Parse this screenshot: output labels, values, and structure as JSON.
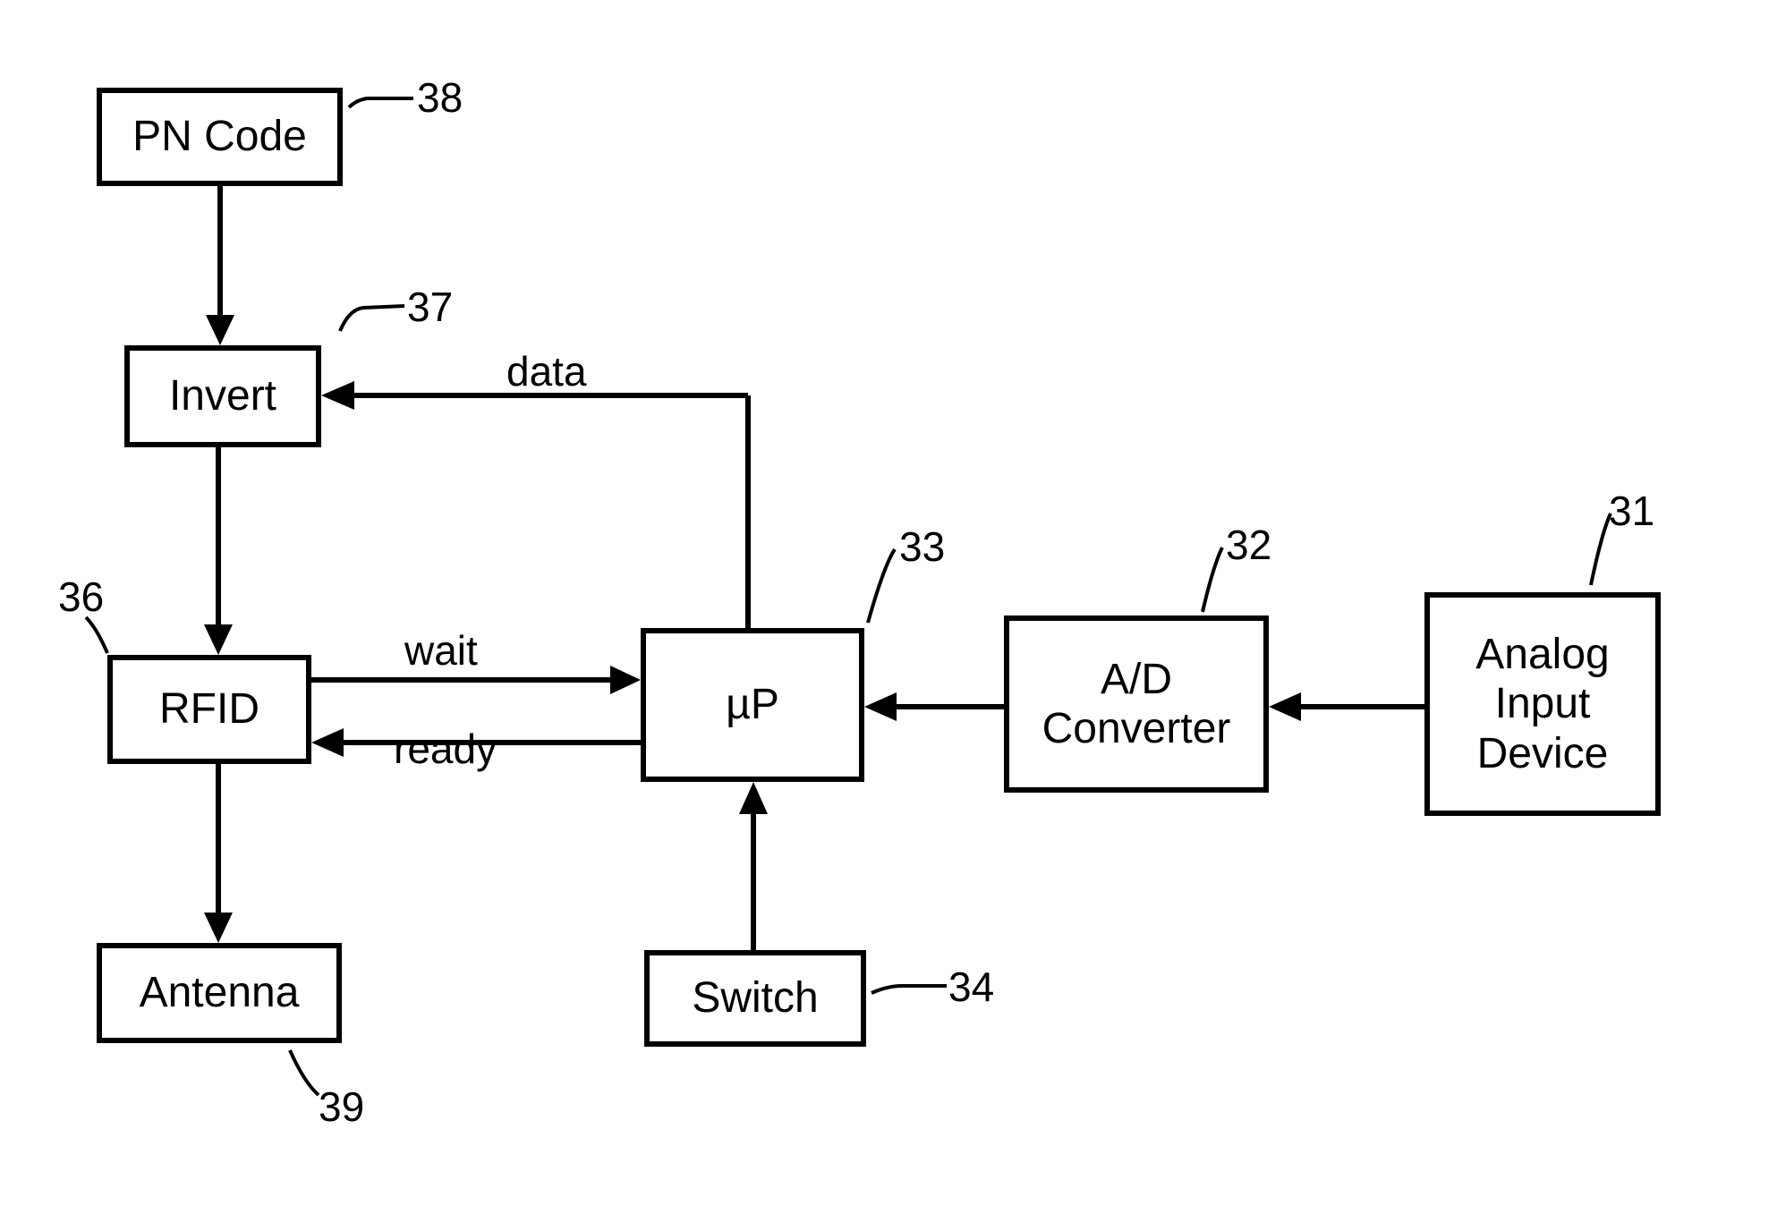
{
  "blocks": {
    "pn_code": {
      "label": "PN Code",
      "ref": "38"
    },
    "invert": {
      "label": "Invert",
      "ref": "37"
    },
    "rfid": {
      "label": "RFID",
      "ref": "36"
    },
    "antenna": {
      "label": "Antenna",
      "ref": "39"
    },
    "mu_p": {
      "label": "µP",
      "ref": "33"
    },
    "switch": {
      "label": "Switch",
      "ref": "34"
    },
    "adc": {
      "label": "A/D\nConverter",
      "ref": "32"
    },
    "analog": {
      "label": "Analog\nInput\nDevice",
      "ref": "31"
    }
  },
  "edge_labels": {
    "data": "data",
    "wait": "wait",
    "ready": "ready"
  }
}
